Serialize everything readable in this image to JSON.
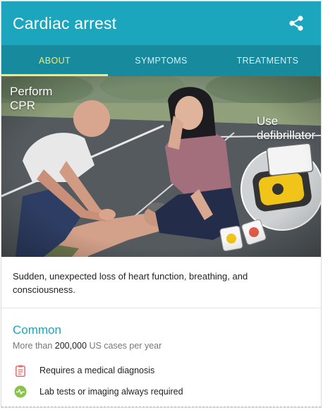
{
  "header": {
    "title": "Cardiac arrest",
    "share_icon": "share-icon"
  },
  "tabs": [
    {
      "label": "ABOUT",
      "active": true
    },
    {
      "label": "SYMPTOMS",
      "active": false
    },
    {
      "label": "TREATMENTS",
      "active": false
    }
  ],
  "illustration": {
    "label_left_line1": "Perform",
    "label_left_line2": "CPR",
    "label_right_line1": "Use",
    "label_right_line2": "defibrillator"
  },
  "description": "Sudden, unexpected loss of heart function, breathing, and consciousness.",
  "prevalence": {
    "title": "Common",
    "prefix": "More than",
    "count": "200,000",
    "suffix": "US cases per year"
  },
  "facts": [
    {
      "icon": "clipboard-icon",
      "label": "Requires a medical diagnosis",
      "color": "#e86a6a"
    },
    {
      "icon": "pulse-icon",
      "label": "Lab tests or imaging always required",
      "color": "#8bc34a"
    }
  ],
  "colors": {
    "header": "#1ba6bd",
    "tabs": "#178a9d",
    "active_tab": "#ffe56b",
    "accent": "#1ba6bd"
  }
}
